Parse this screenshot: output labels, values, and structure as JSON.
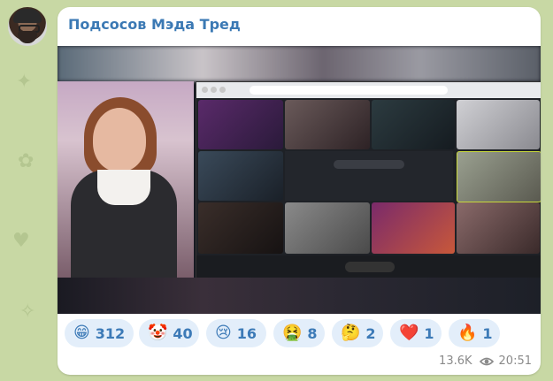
{
  "post": {
    "channel_name": "Подсосов Мэда Тред"
  },
  "reactions": [
    {
      "emoji": "😁",
      "count": "312"
    },
    {
      "emoji": "🤡",
      "count": "40"
    },
    {
      "emoji": "😢",
      "count": "16"
    },
    {
      "emoji": "🤮",
      "count": "8"
    },
    {
      "emoji": "🤔",
      "count": "2"
    },
    {
      "emoji": "❤️",
      "count": "1"
    },
    {
      "emoji": "🔥",
      "count": "1"
    }
  ],
  "footer": {
    "views": "13.6K",
    "time": "20:51"
  },
  "colors": {
    "background": "#c8d8a4",
    "bubble": "#ffffff",
    "channel_name": "#3b79b4",
    "reaction_chip": "#e3eefa",
    "reaction_text": "#3c7ab7",
    "meta_text": "#8a8a8a"
  },
  "icons": {
    "views": "eye-icon",
    "avatar": "avatar"
  }
}
